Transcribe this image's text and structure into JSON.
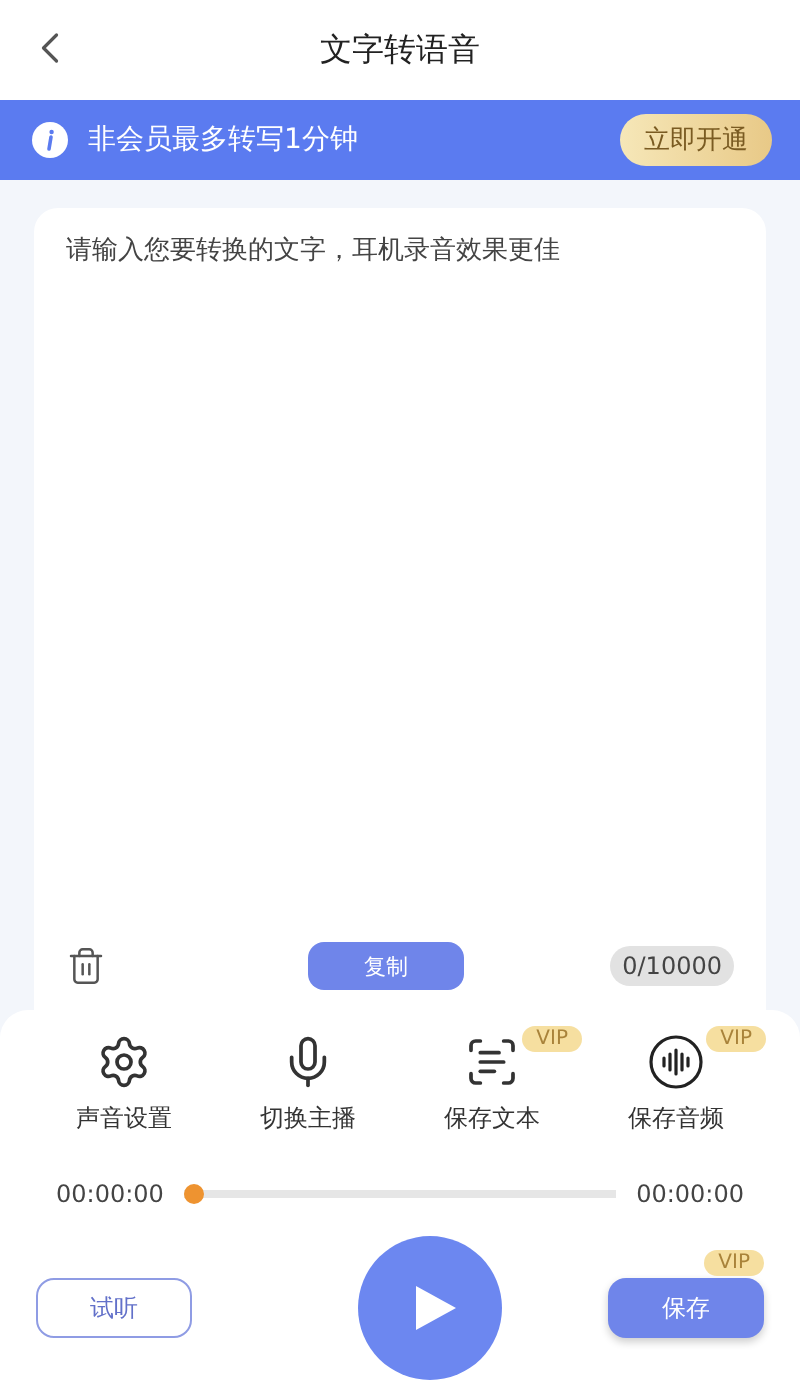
{
  "header": {
    "title": "文字转语音"
  },
  "banner": {
    "text": "非会员最多转写1分钟",
    "action": "立即开通"
  },
  "editor": {
    "placeholder": "请输入您要转换的文字，耳机录音效果更佳",
    "copy": "复制",
    "count": "0/10000"
  },
  "tools": [
    {
      "kind": "gear",
      "label": "声音设置"
    },
    {
      "kind": "mic",
      "label": "切换主播"
    },
    {
      "kind": "text",
      "label": "保存文本",
      "badge": "VIP"
    },
    {
      "kind": "audio",
      "label": "保存音频",
      "badge": "VIP"
    }
  ],
  "player": {
    "start": "00:00:00",
    "end": "00:00:00",
    "level": 0
  },
  "actions": {
    "preview": "试听",
    "save": "保存",
    "save_badge": "VIP"
  }
}
